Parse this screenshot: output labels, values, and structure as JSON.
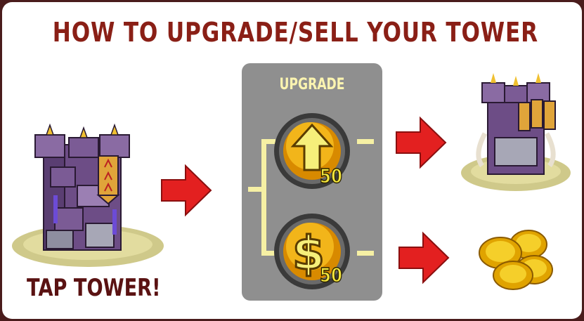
{
  "title": "HOW TO UPGRADE/SELL YOUR TOWER",
  "menu": {
    "label": "UPGRADE",
    "upgrade_button": {
      "icon": "up-arrow-icon",
      "cost": "50"
    },
    "sell_button": {
      "icon": "dollar-icon",
      "cost": "50"
    }
  },
  "step1_caption": "TAP TOWER!",
  "colors": {
    "title": "#8a1f16",
    "panel": "#8f8f8f",
    "arrow": "#e32020",
    "coin": "#e0a300"
  }
}
